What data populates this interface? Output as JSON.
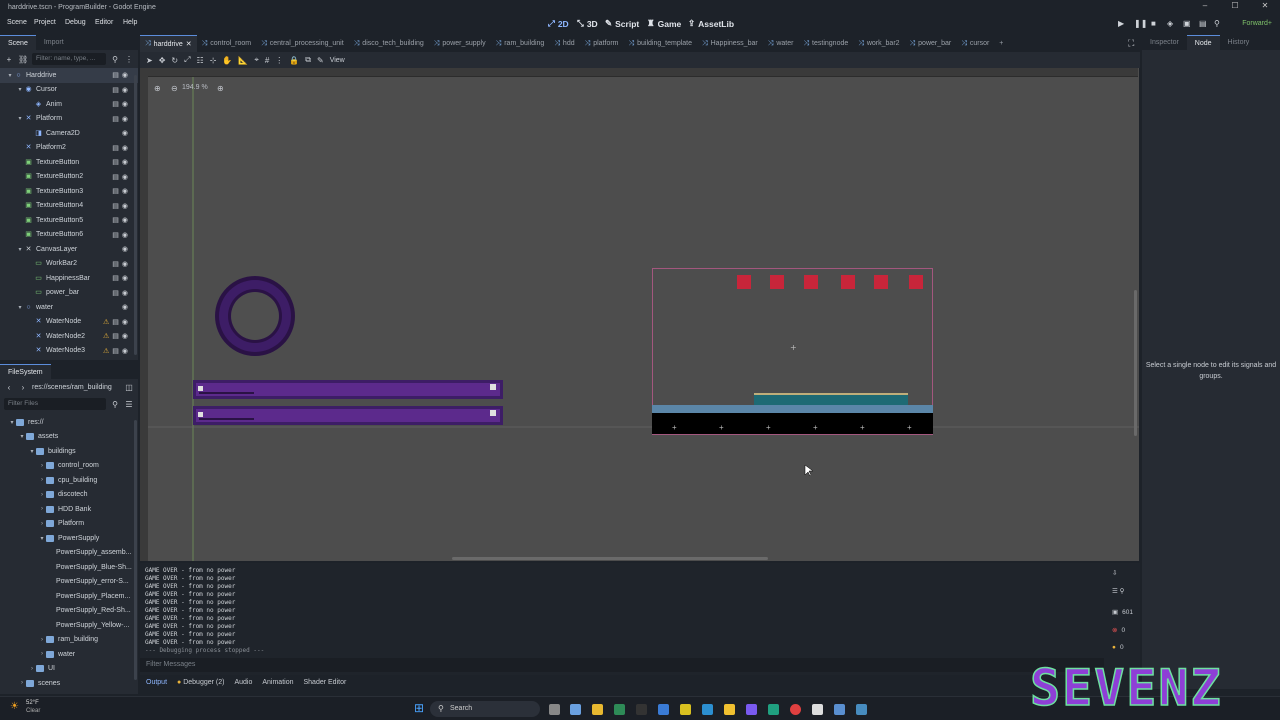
{
  "window": {
    "title": "harddrive.tscn - ProgramBuilder - Godot Engine"
  },
  "menu": [
    "Scene",
    "Project",
    "Debug",
    "Editor",
    "Help"
  ],
  "workspaces": [
    {
      "label": "2D",
      "icon": "2d-icon",
      "active": true
    },
    {
      "label": "3D",
      "icon": "3d-icon",
      "active": false
    },
    {
      "label": "Script",
      "icon": "script-icon",
      "active": false
    },
    {
      "label": "Game",
      "icon": "game-icon",
      "active": false
    },
    {
      "label": "AssetLib",
      "icon": "assetlib-icon",
      "active": false
    }
  ],
  "renderer": "Forward+",
  "sceneDock": {
    "tabs": [
      "Scene",
      "Import"
    ],
    "filter_placeholder": "Filter: name, type, ...",
    "nodes": [
      {
        "name": "Harddrive",
        "indent": 0,
        "icon": "node2d-icon",
        "arrow": "▾",
        "selected": true
      },
      {
        "name": "Cursor",
        "indent": 1,
        "icon": "area-icon",
        "arrow": "▾"
      },
      {
        "name": "Anim",
        "indent": 2,
        "icon": "animated-sprite-icon",
        "arrow": ""
      },
      {
        "name": "Platform",
        "indent": 1,
        "icon": "static-body-icon",
        "arrow": "▾"
      },
      {
        "name": "Camera2D",
        "indent": 2,
        "icon": "camera-icon",
        "arrow": ""
      },
      {
        "name": "Platform2",
        "indent": 1,
        "icon": "static-body-icon",
        "arrow": ""
      },
      {
        "name": "TextureButton",
        "indent": 1,
        "icon": "texture-button-icon",
        "arrow": ""
      },
      {
        "name": "TextureButton2",
        "indent": 1,
        "icon": "texture-button-icon",
        "arrow": ""
      },
      {
        "name": "TextureButton3",
        "indent": 1,
        "icon": "texture-button-icon",
        "arrow": ""
      },
      {
        "name": "TextureButton4",
        "indent": 1,
        "icon": "texture-button-icon",
        "arrow": ""
      },
      {
        "name": "TextureButton5",
        "indent": 1,
        "icon": "texture-button-icon",
        "arrow": ""
      },
      {
        "name": "TextureButton6",
        "indent": 1,
        "icon": "texture-button-icon",
        "arrow": ""
      },
      {
        "name": "CanvasLayer",
        "indent": 1,
        "icon": "canvas-layer-icon",
        "arrow": "▾"
      },
      {
        "name": "WorkBar2",
        "indent": 2,
        "icon": "control-icon",
        "arrow": ""
      },
      {
        "name": "HappinessBar",
        "indent": 2,
        "icon": "control-icon",
        "arrow": ""
      },
      {
        "name": "power_bar",
        "indent": 2,
        "icon": "control-icon",
        "arrow": ""
      },
      {
        "name": "water",
        "indent": 1,
        "icon": "node2d-icon",
        "arrow": "▾"
      },
      {
        "name": "WaterNode",
        "indent": 2,
        "icon": "static-body-icon",
        "arrow": "",
        "warning": true
      },
      {
        "name": "WaterNode2",
        "indent": 2,
        "icon": "static-body-icon",
        "arrow": "",
        "warning": true
      },
      {
        "name": "WaterNode3",
        "indent": 2,
        "icon": "static-body-icon",
        "arrow": "",
        "warning": true
      }
    ]
  },
  "fsDock": {
    "title": "FileSystem",
    "path": "res://scenes/ram_building",
    "filter_placeholder": "Filter Files",
    "items": [
      {
        "name": "res://",
        "indent": 0,
        "type": "folder",
        "arrow": "▾"
      },
      {
        "name": "assets",
        "indent": 1,
        "type": "folder",
        "arrow": "▾"
      },
      {
        "name": "buildings",
        "indent": 2,
        "type": "folder",
        "arrow": "▾"
      },
      {
        "name": "control_room",
        "indent": 3,
        "type": "folder",
        "arrow": "›"
      },
      {
        "name": "cpu_building",
        "indent": 3,
        "type": "folder",
        "arrow": "›"
      },
      {
        "name": "discotech",
        "indent": 3,
        "type": "folder",
        "arrow": "›"
      },
      {
        "name": "HDD Bank",
        "indent": 3,
        "type": "folder",
        "arrow": "›"
      },
      {
        "name": "Platform",
        "indent": 3,
        "type": "folder",
        "arrow": "›"
      },
      {
        "name": "PowerSupply",
        "indent": 3,
        "type": "folder",
        "arrow": "▾"
      },
      {
        "name": "PowerSupply_assemb...",
        "indent": 4,
        "type": "file",
        "arrow": ""
      },
      {
        "name": "PowerSupply_Blue-Sh...",
        "indent": 4,
        "type": "file",
        "arrow": ""
      },
      {
        "name": "PowerSupply_error-S...",
        "indent": 4,
        "type": "file",
        "arrow": ""
      },
      {
        "name": "PowerSupply_Placem...",
        "indent": 4,
        "type": "file",
        "arrow": ""
      },
      {
        "name": "PowerSupply_Red-Sh...",
        "indent": 4,
        "type": "file",
        "arrow": ""
      },
      {
        "name": "PowerSupply_Yellow-...",
        "indent": 4,
        "type": "file",
        "arrow": ""
      },
      {
        "name": "ram_building",
        "indent": 3,
        "type": "folder",
        "arrow": "›"
      },
      {
        "name": "water",
        "indent": 3,
        "type": "folder",
        "arrow": "›"
      },
      {
        "name": "UI",
        "indent": 2,
        "type": "folder",
        "arrow": "›"
      },
      {
        "name": "scenes",
        "indent": 1,
        "type": "folder",
        "arrow": "›"
      }
    ]
  },
  "sceneTabs": [
    {
      "label": "harddrive",
      "active": true
    },
    {
      "label": "control_room"
    },
    {
      "label": "central_processing_unit"
    },
    {
      "label": "disco_tech_building"
    },
    {
      "label": "power_supply"
    },
    {
      "label": "ram_building"
    },
    {
      "label": "hdd"
    },
    {
      "label": "platform"
    },
    {
      "label": "building_template"
    },
    {
      "label": "Happiness_bar"
    },
    {
      "label": "water"
    },
    {
      "label": "testingnode"
    },
    {
      "label": "work_bar2"
    },
    {
      "label": "power_bar"
    },
    {
      "label": "cursor"
    }
  ],
  "toolbar2d": {
    "view_label": "View"
  },
  "viewport": {
    "zoom": "194.9 %"
  },
  "output": {
    "lines": [
      "GAME OVER - from no power",
      "GAME OVER - from no power",
      "GAME OVER - from no power",
      "GAME OVER - from no power",
      "GAME OVER - from no power",
      "GAME OVER - from no power",
      "GAME OVER - from no power",
      "GAME OVER - from no power",
      "GAME OVER - from no power",
      "GAME OVER - from no power",
      "--- Debugging process stopped ---"
    ],
    "filter_placeholder": "Filter Messages",
    "counts": {
      "messages": "601",
      "errors": "0",
      "warnings": "0"
    }
  },
  "bottomTabs": [
    "Output",
    "Debugger (2)",
    "Audio",
    "Animation",
    "Shader Editor"
  ],
  "inspector": {
    "tabs": [
      "Inspector",
      "Node",
      "History"
    ],
    "active": "Node",
    "hint": "Select a single node to edit its signals and groups."
  },
  "taskbar": {
    "weather_temp": "52°F",
    "weather_text": "Clear",
    "search_label": "Search"
  },
  "watermark": {
    "text": "SEVENZ"
  },
  "colors": {
    "accent": "#5c8ddb",
    "viewport_bg": "#4d4d4d",
    "dock_bg": "#262b33",
    "purple": "#3d1d66",
    "red_block": "#c8253a"
  }
}
